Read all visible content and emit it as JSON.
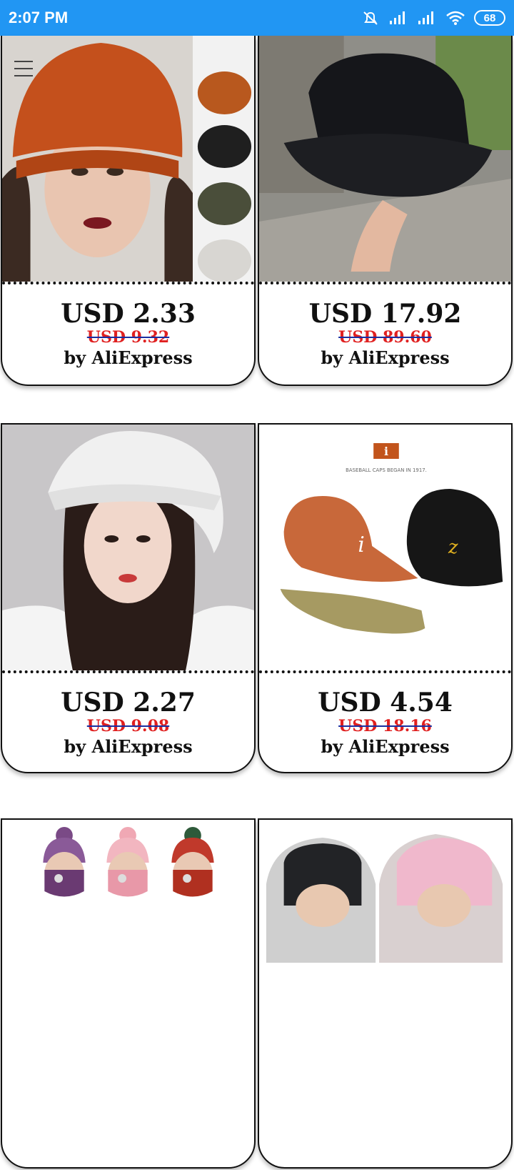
{
  "status": {
    "time": "2:07 PM",
    "battery": "68",
    "icons": [
      "alarm-off-icon",
      "signal-icon",
      "signal-icon",
      "wifi-icon",
      "battery-icon"
    ]
  },
  "menu": {
    "icon": "hamburger-menu-icon"
  },
  "products": [
    {
      "price": "USD 2.33",
      "old_price": "USD 9.32",
      "seller": "by AliExpress",
      "image": "knit-beanie-photo"
    },
    {
      "price": "USD 17.92",
      "old_price": "USD 89.60",
      "seller": "by AliExpress",
      "image": "black-bucket-hat-photo"
    },
    {
      "price": "USD 2.27",
      "old_price": "USD 9.08",
      "seller": "by AliExpress",
      "image": "lace-sun-hat-photo"
    },
    {
      "price": "USD 4.54",
      "old_price": "USD 18.16",
      "seller": "by AliExpress",
      "image": "baseball-caps-photo",
      "image_label": "BASEBALL CAPS BEGAN IN 1917."
    },
    {
      "price": "",
      "old_price": "",
      "seller": "",
      "image": "winter-hat-mask-set-photo"
    },
    {
      "price": "",
      "old_price": "",
      "seller": "",
      "image": "fur-trapper-hat-photo"
    }
  ]
}
